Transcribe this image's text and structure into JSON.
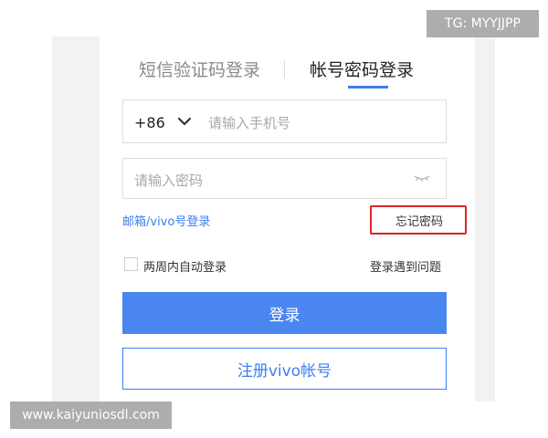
{
  "tabs": {
    "sms_login": "短信验证码登录",
    "password_login": "帐号密码登录"
  },
  "phone": {
    "country_code": "+86",
    "placeholder": "请输入手机号"
  },
  "password": {
    "placeholder": "请输入密码"
  },
  "links": {
    "email_login": "邮箱/vivo号登录",
    "forgot_password": "忘记密码",
    "login_problem": "登录遇到问题"
  },
  "remember": {
    "label": "两周内自动登录",
    "checked": false
  },
  "buttons": {
    "login": "登录",
    "register": "注册vivo帐号"
  },
  "watermarks": {
    "top": "TG: MYYJJPP",
    "bottom": "www.kaiyuniosdl.com"
  },
  "colors": {
    "accent": "#3d7ef2",
    "login_button": "#4a86f0",
    "highlight_box": "#e02424"
  }
}
